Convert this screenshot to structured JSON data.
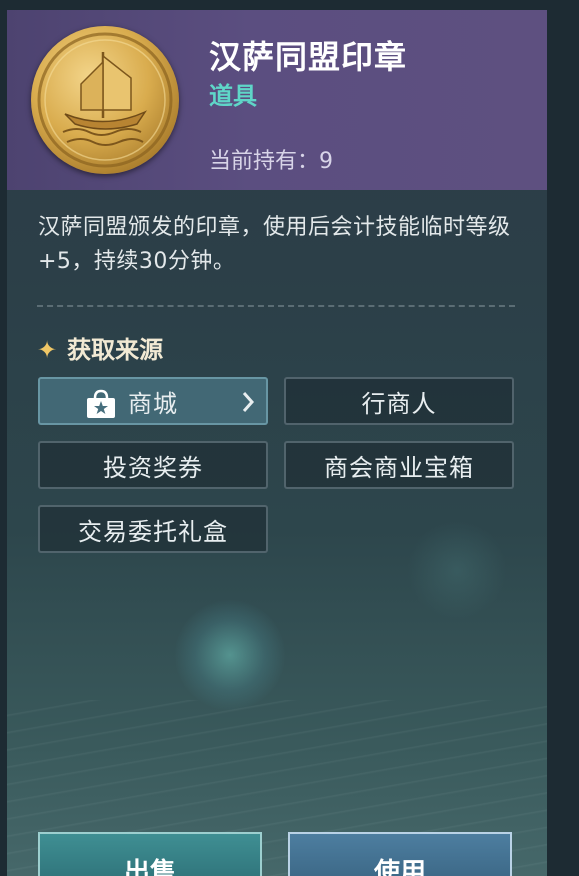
{
  "item": {
    "name": "汉萨同盟印章",
    "type": "道具",
    "owned_label": "当前持有：",
    "owned_count": "9",
    "icon": "hansa-coin-icon",
    "description": "汉萨同盟颁发的印章，使用后会计技能临时等级+5，持续30分钟。"
  },
  "sources": {
    "title": "获取来源",
    "title_icon": "sparkle-icon",
    "items": [
      {
        "label": "商城",
        "icon": "shop-bag-icon",
        "active": true
      },
      {
        "label": "行商人"
      },
      {
        "label": "投资奖券"
      },
      {
        "label": "商会商业宝箱"
      },
      {
        "label": "交易委托礼盒"
      }
    ]
  },
  "actions": {
    "sell_label": "出售",
    "use_label": "使用"
  },
  "colors": {
    "header": "#5b4e80",
    "type_accent": "#5fd6c8",
    "star": "#f0c766",
    "sell": "#3f8f93",
    "use": "#4d7ea0"
  }
}
